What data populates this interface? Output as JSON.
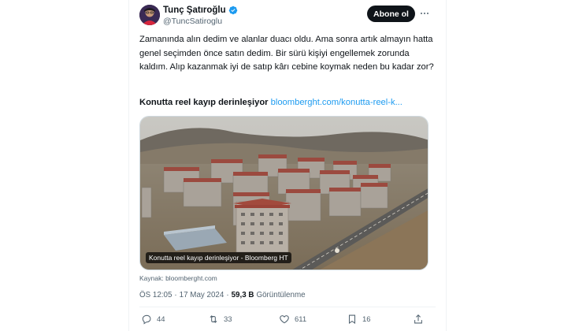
{
  "author": {
    "name": "Tunç Şatıroğlu",
    "handle": "@TuncSatiroglu"
  },
  "follow_label": "Abone ol",
  "tweet": {
    "text": "Zamanında alın dedim ve alanlar duacı oldu. Ama sonra artık almayın hatta genel seçimden önce satın dedim. Bir sürü kişiyi engellemek zorunda kaldım. Alıp kazanmak iyi de satıp kârı cebine koymak neden bu kadar zor?",
    "link_title": "Konutta reel kayıp derinleşiyor",
    "link_url": "bloomberght.com/konutta-reel-k..."
  },
  "card": {
    "caption": "Konutta reel kayıp derinleşiyor - Bloomberg HT",
    "source": "Kaynak: bloomberght.com"
  },
  "meta": {
    "time": "ÖS 12:05",
    "separator": "·",
    "date": "17 May 2024",
    "views": "59,3 B",
    "views_label": "Görüntülenme"
  },
  "actions": {
    "replies": "44",
    "retweets": "33",
    "likes": "611",
    "bookmarks": "16"
  },
  "colors": {
    "link": "#1d9bf0",
    "verified": "#1d9bf0",
    "follow_bg": "#0f1419",
    "muted": "#536471"
  }
}
